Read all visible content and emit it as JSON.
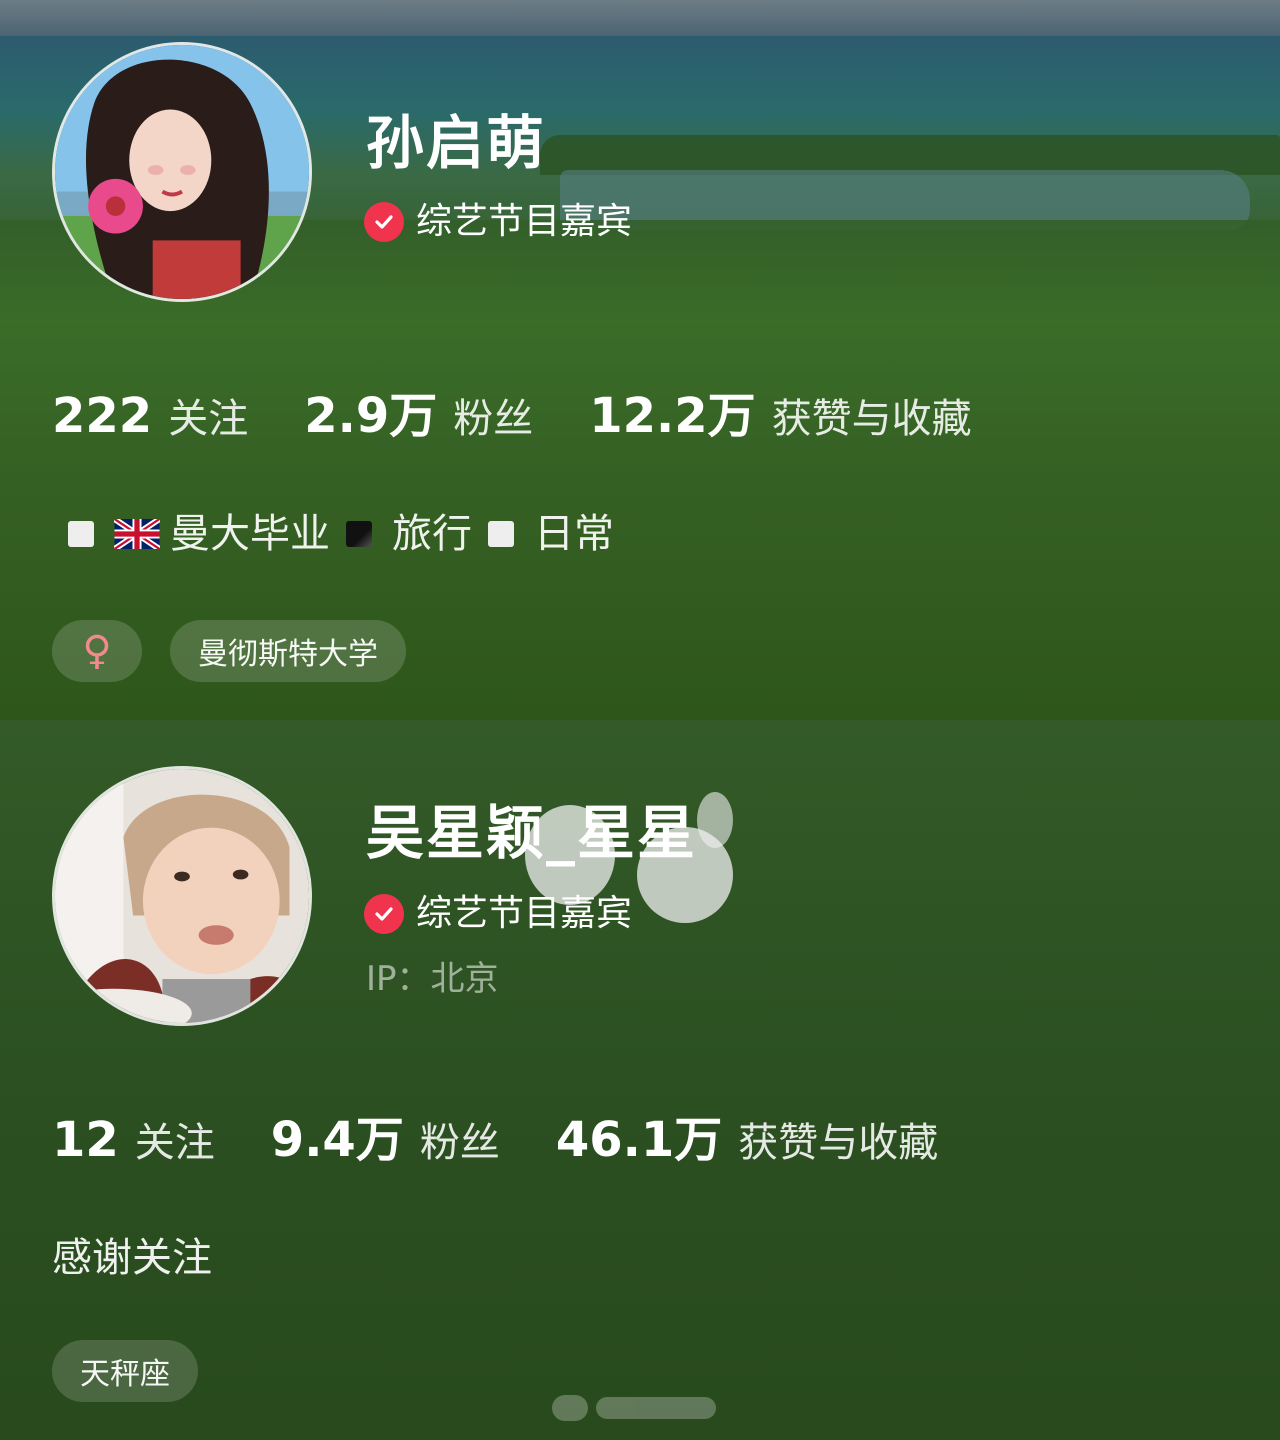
{
  "profile1": {
    "name": "孙启萌",
    "verify_label": "综艺节目嘉宾",
    "stats": [
      {
        "num": "222",
        "label": "关注"
      },
      {
        "num": "2.9万",
        "label": "粉丝"
      },
      {
        "num": "12.2万",
        "label": "获赞与收藏"
      }
    ],
    "bio": {
      "part1": "曼大毕业",
      "part2": "旅行",
      "part3": "日常"
    },
    "gender_symbol": "♀",
    "tag_school": "曼彻斯特大学"
  },
  "profile2": {
    "name": "吴星颖_星星",
    "verify_label": "综艺节目嘉宾",
    "ip": "IP：北京",
    "stats": [
      {
        "num": "12",
        "label": "关注"
      },
      {
        "num": "9.4万",
        "label": "粉丝"
      },
      {
        "num": "46.1万",
        "label": "获赞与收藏"
      }
    ],
    "bio": "感谢关注",
    "tag_zodiac": "天秤座"
  },
  "colors": {
    "verify_red": "#f0344e",
    "female_pink": "#f18a8e"
  },
  "icons": [
    "check-icon",
    "uk-flag-icon",
    "female-icon"
  ]
}
